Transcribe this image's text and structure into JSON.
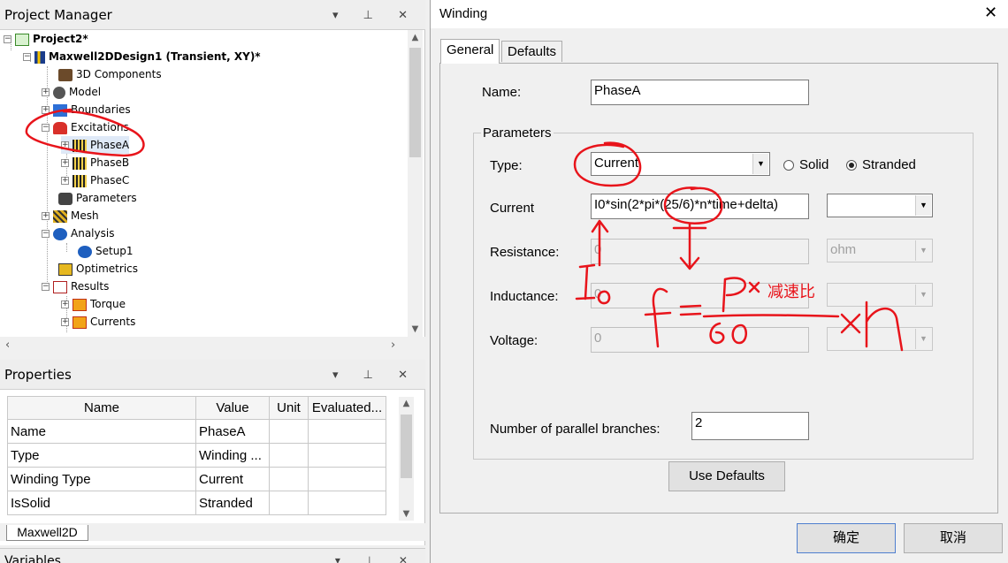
{
  "project_manager": {
    "title": "Project Manager",
    "tree": [
      {
        "label": "Project2*",
        "bold": true
      },
      {
        "label": "Maxwell2DDesign1 (Transient, XY)*",
        "bold": true
      },
      {
        "label": "3D Components"
      },
      {
        "label": "Model"
      },
      {
        "label": "Boundaries"
      },
      {
        "label": "Excitations"
      },
      {
        "label": "PhaseA"
      },
      {
        "label": "PhaseB"
      },
      {
        "label": "PhaseC"
      },
      {
        "label": "Parameters"
      },
      {
        "label": "Mesh"
      },
      {
        "label": "Analysis"
      },
      {
        "label": "Setup1"
      },
      {
        "label": "Optimetrics"
      },
      {
        "label": "Results"
      },
      {
        "label": "Torque"
      },
      {
        "label": "Currents"
      }
    ]
  },
  "properties": {
    "title": "Properties",
    "columns": [
      "Name",
      "Value",
      "Unit",
      "Evaluated..."
    ],
    "rows": [
      [
        "Name",
        "PhaseA",
        "",
        ""
      ],
      [
        "Type",
        "Winding ...",
        "",
        ""
      ],
      [
        "Winding Type",
        "Current",
        "",
        ""
      ],
      [
        "IsSolid",
        "Stranded",
        "",
        ""
      ]
    ],
    "tab": "Maxwell2D",
    "next_panel": "Variables"
  },
  "dialog": {
    "title": "Winding",
    "tabs": [
      "General",
      "Defaults"
    ],
    "name_label": "Name:",
    "name_value": "PhaseA",
    "group_label": "Parameters",
    "type_label": "Type:",
    "type_value": "Current",
    "radio_solid": "Solid",
    "radio_stranded": "Stranded",
    "current_label": "Current",
    "current_value": "I0*sin(2*pi*(25/6)*n*time+delta)",
    "resistance_label": "Resistance:",
    "resistance_value": "0",
    "resistance_unit": "ohm",
    "inductance_label": "Inductance:",
    "inductance_value": "0",
    "voltage_label": "Voltage:",
    "voltage_value": "0",
    "branches_label": "Number of parallel branches:",
    "branches_value": "2",
    "use_defaults": "Use Defaults",
    "ok": "确定",
    "cancel": "取消"
  },
  "annotation": {
    "text": "减速比",
    "ink_color": "#e8141b"
  }
}
